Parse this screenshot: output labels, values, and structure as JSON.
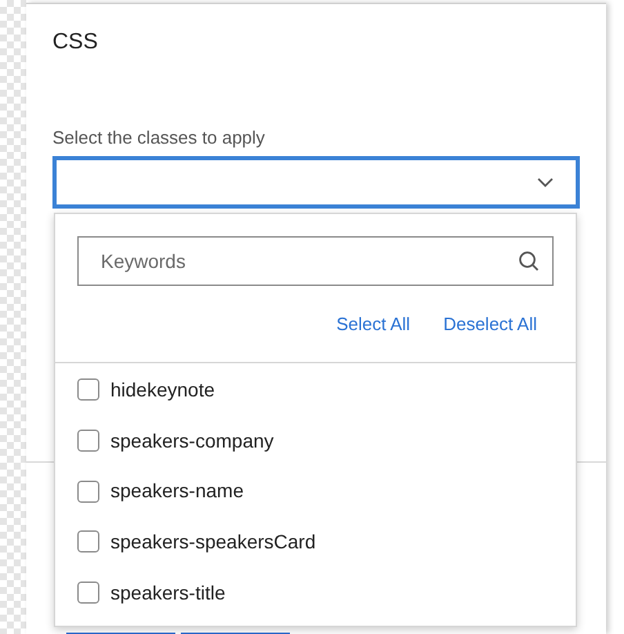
{
  "panel": {
    "title": "CSS"
  },
  "class_select": {
    "label": "Select the classes to apply",
    "focused": true,
    "expanded": true
  },
  "dropdown": {
    "search": {
      "placeholder": "Keywords"
    },
    "actions": [
      "Select All",
      "Deselect All"
    ],
    "options": [
      {
        "label": "hidekeynote",
        "checked": false
      },
      {
        "label": "speakers-company",
        "checked": false
      },
      {
        "label": "speakers-name",
        "checked": false
      },
      {
        "label": "speakers-speakersCard",
        "checked": false
      },
      {
        "label": "speakers-title",
        "checked": false
      }
    ]
  }
}
